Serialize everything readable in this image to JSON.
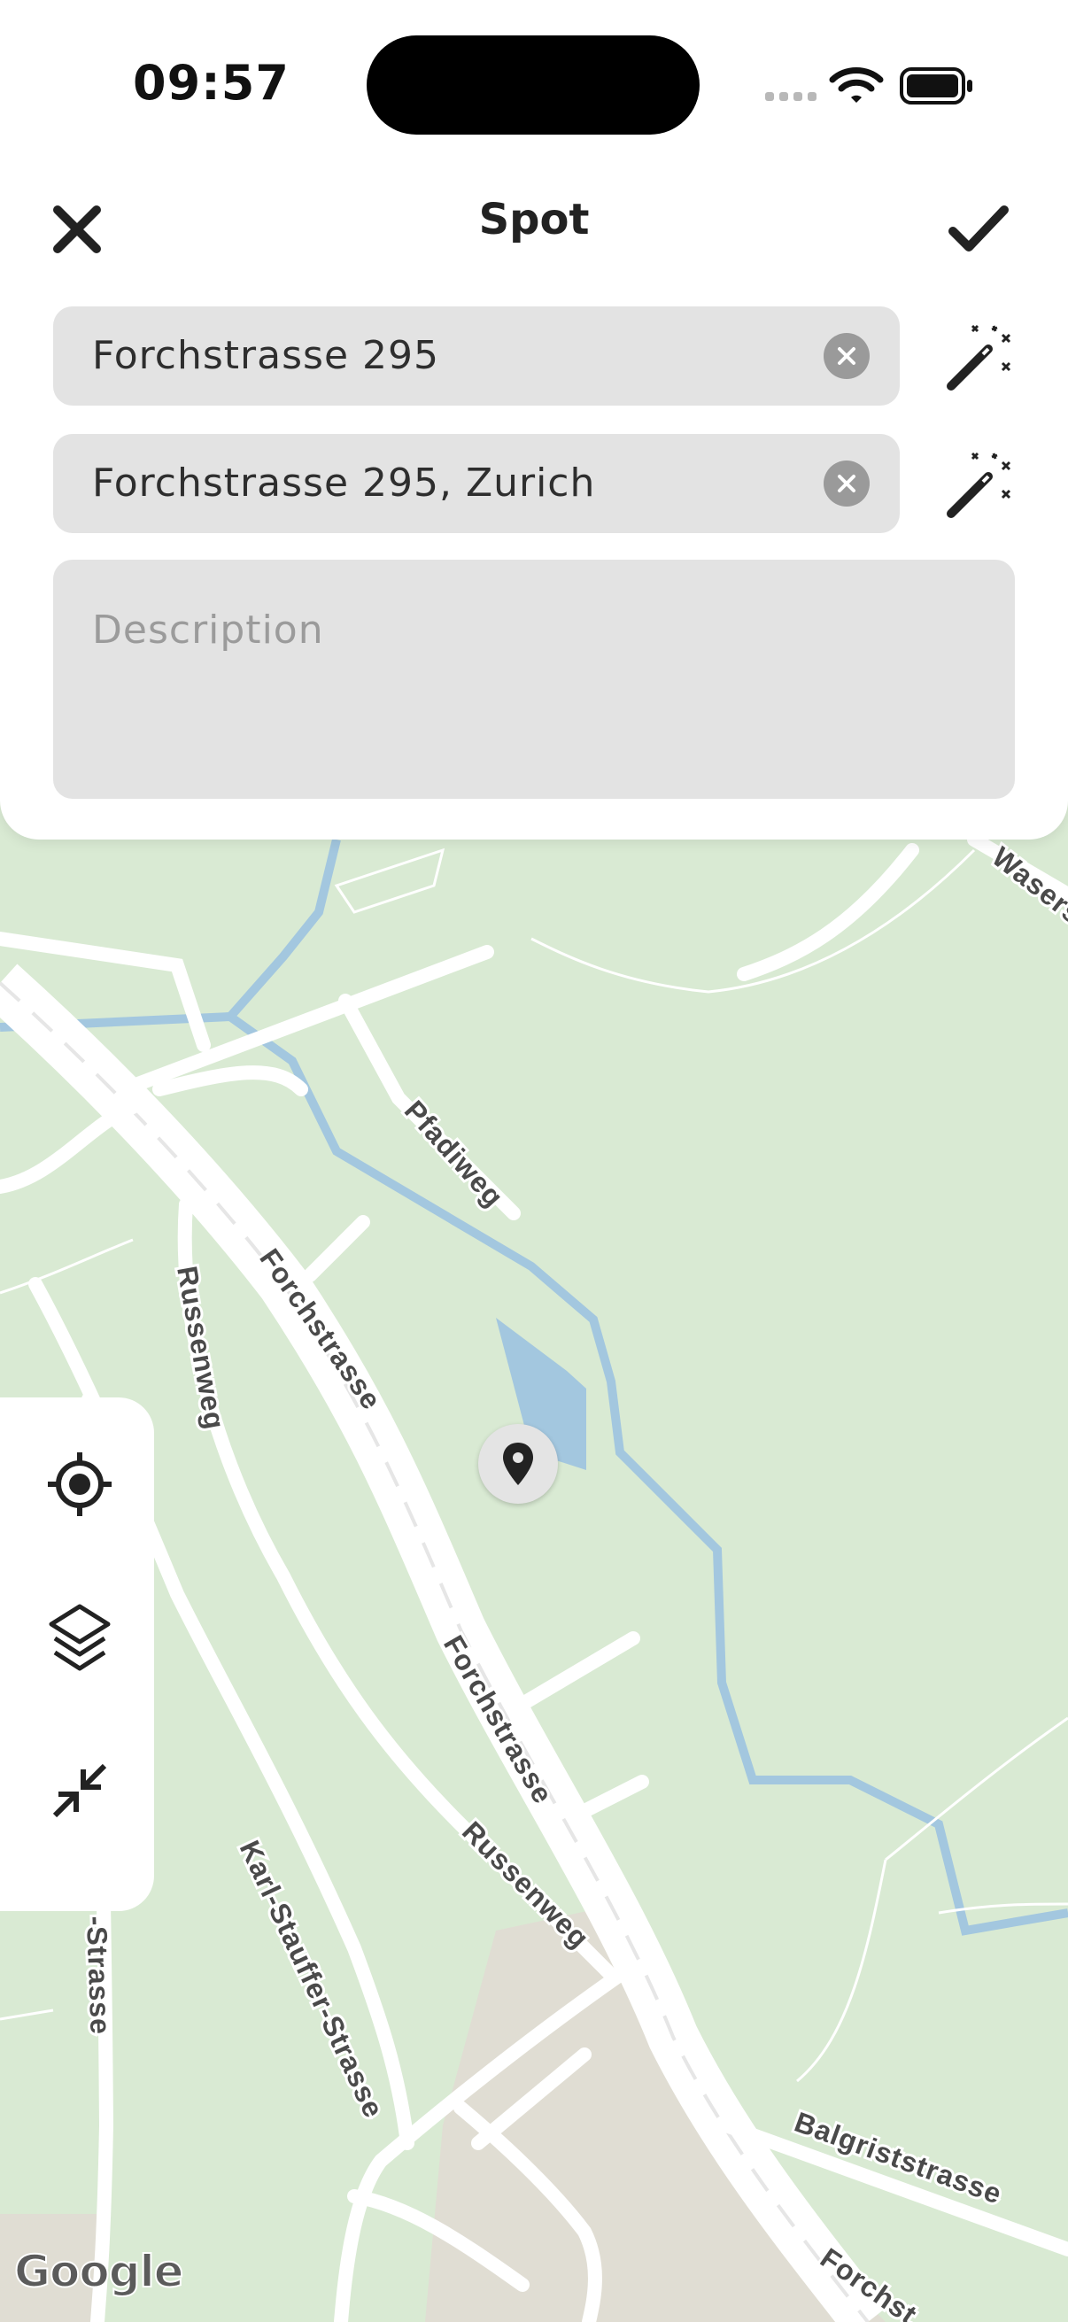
{
  "status_bar": {
    "time": "09:57"
  },
  "header": {
    "title": "Spot"
  },
  "fields": {
    "name": {
      "value": "Forchstrasse 295"
    },
    "address": {
      "value": "Forchstrasse 295, Zurich"
    },
    "description": {
      "placeholder": "Description"
    }
  },
  "map": {
    "streets": {
      "forchstrasse_1": "Forchstrasse",
      "forchstrasse_2": "Forchstrasse",
      "forchstrasse_3": "Forchst",
      "pfadiweg": "Pfadiweg",
      "russenweg_1": "Russenweg",
      "russenweg_2": "Russenweg",
      "karl_stauffer": "Karl-Stauffer-Strasse",
      "balgrist": "Balgriststrasse",
      "strasse_left": "-Strasse",
      "wasers": "Wasers"
    },
    "attribution": "Google"
  },
  "icons": {
    "close": "close-icon",
    "confirm": "checkmark-icon",
    "clear": "clear-circle-icon",
    "magic": "magic-wand-icon",
    "locate": "location-target-icon",
    "layers": "layers-icon",
    "collapse": "collapse-arrows-icon",
    "pin": "map-pin-icon"
  },
  "colors": {
    "map_background": "#d9ead3",
    "road": "#ffffff",
    "river": "#a3c7df",
    "urban_area": "#e0ddd3",
    "field_background": "#e3e3e3"
  }
}
